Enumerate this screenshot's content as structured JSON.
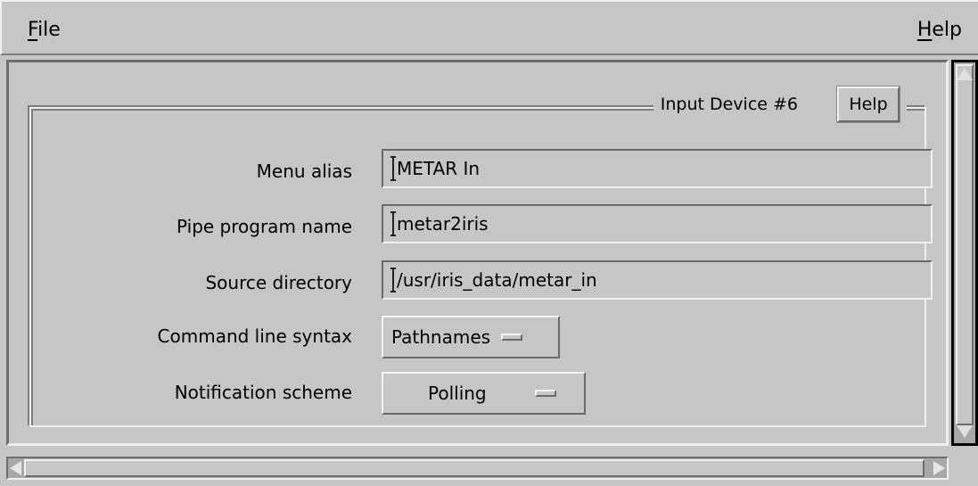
{
  "menubar": {
    "file": {
      "mnemonic": "F",
      "rest": "ile"
    },
    "help": {
      "mnemonic": "H",
      "rest": "elp"
    }
  },
  "group": {
    "title": "Input Device #6",
    "help_label": "Help"
  },
  "fields": {
    "menu_alias": {
      "label": "Menu alias",
      "value": "METAR In"
    },
    "pipe_program": {
      "label": "Pipe program name",
      "value": "metar2iris"
    },
    "source_directory": {
      "label": "Source directory",
      "value": "/usr/iris_data/metar_in"
    }
  },
  "options": {
    "command_line_syntax": {
      "label": "Command line syntax",
      "value": "Pathnames"
    },
    "notification_scheme": {
      "label": "Notification scheme",
      "value": "Polling"
    }
  }
}
